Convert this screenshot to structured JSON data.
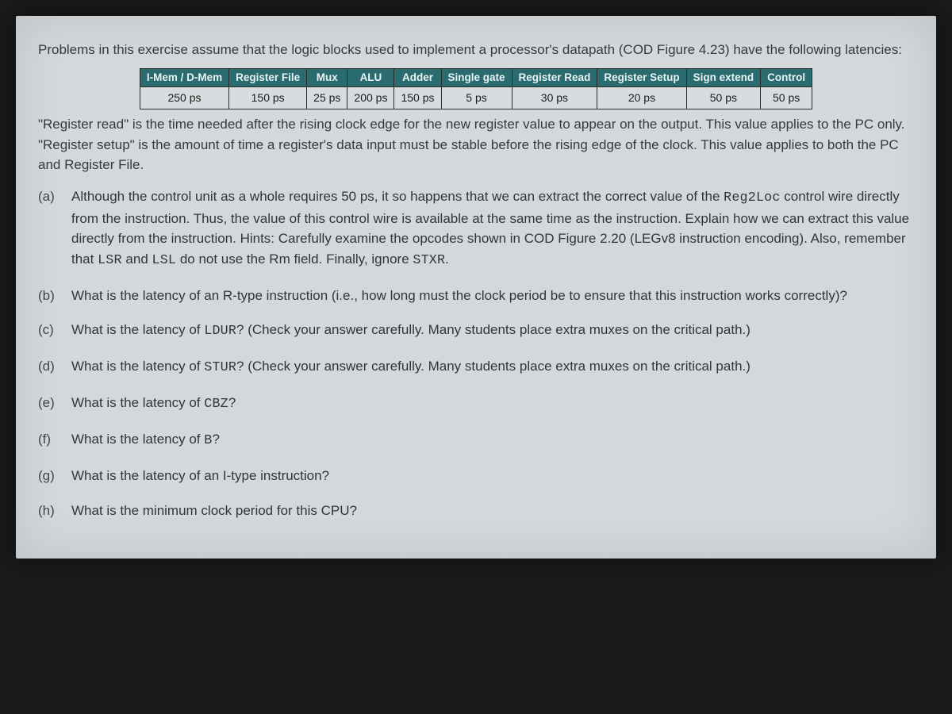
{
  "intro": "Problems in this exercise assume that the logic blocks used to implement a processor's datapath (COD Figure 4.23) have the following latencies:",
  "table": {
    "headers": [
      "I-Mem / D-Mem",
      "Register File",
      "Mux",
      "ALU",
      "Adder",
      "Single gate",
      "Register Read",
      "Register Setup",
      "Sign extend",
      "Control"
    ],
    "values": [
      "250 ps",
      "150 ps",
      "25 ps",
      "200 ps",
      "150 ps",
      "5 ps",
      "30 ps",
      "20 ps",
      "50 ps",
      "50 ps"
    ]
  },
  "note": "\"Register read\" is the time needed after the rising clock edge for the new register value to appear on the output. This value applies to the PC only. \"Register setup\" is the amount of time a register's data input must be stable before the rising edge of the clock. This value applies to both the PC and Register File.",
  "questions": {
    "a": {
      "marker": "(a)",
      "pre": "Although the control unit as a whole requires 50 ps, it so happens that we can extract the correct value of the ",
      "code1": "Reg2Loc",
      "mid1": " control wire directly from the instruction. Thus, the value of this control wire is available at the same time as the instruction. Explain how we can extract this value directly from the instruction. Hints: Carefully examine the opcodes shown in COD Figure 2.20 (LEGv8 instruction encoding). Also, remember that ",
      "code2": "LSR",
      "mid2": " and ",
      "code3": "LSL",
      "mid3": " do not use the Rm field. Finally, ignore ",
      "code4": "STXR",
      "post": "."
    },
    "b": {
      "marker": "(b)",
      "text": "What is the latency of an R-type instruction (i.e., how long must the clock period be to ensure that this instruction works correctly)?"
    },
    "c": {
      "marker": "(c)",
      "pre": "What is the latency of ",
      "code": "LDUR",
      "post": "? (Check your answer carefully. Many students place extra muxes on the critical path.)"
    },
    "d": {
      "marker": "(d)",
      "pre": "What is the latency of ",
      "code": "STUR",
      "post": "? (Check your answer carefully. Many students place extra muxes on the critical path.)"
    },
    "e": {
      "marker": "(e)",
      "pre": "What is the latency of ",
      "code": "CBZ",
      "post": "?"
    },
    "f": {
      "marker": "(f)",
      "pre": "What is the latency of ",
      "code": "B",
      "post": "?"
    },
    "g": {
      "marker": "(g)",
      "text": "What is the latency of an I-type instruction?"
    },
    "h": {
      "marker": "(h)",
      "text": "What is the minimum clock period for this CPU?"
    }
  }
}
